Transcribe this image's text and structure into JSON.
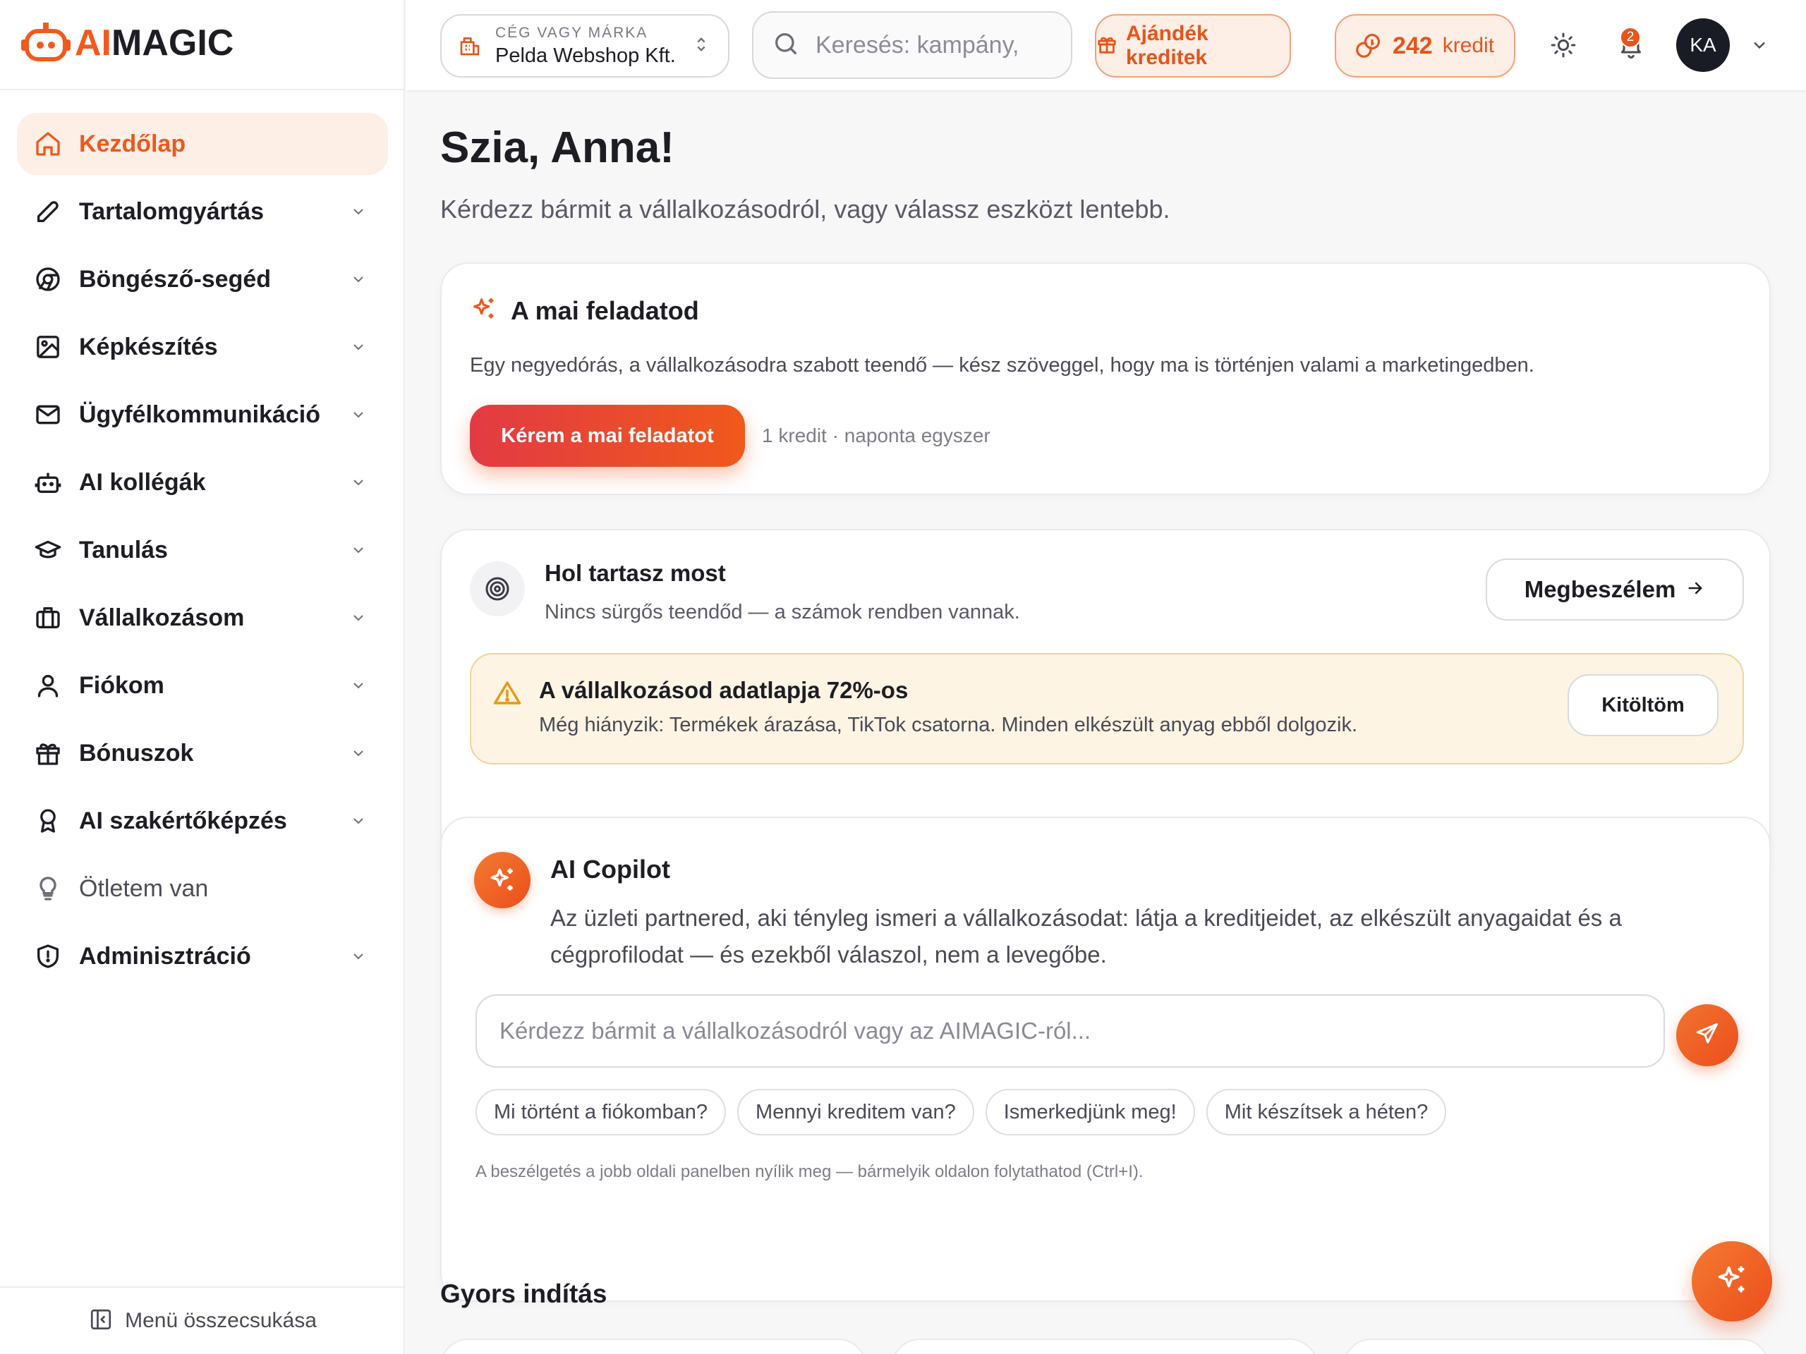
{
  "app": {
    "logo_ai": "AI",
    "logo_magic": "MAGIC"
  },
  "sidebar": {
    "items": [
      {
        "label": "Kezdőlap",
        "icon": "home-icon"
      },
      {
        "label": "Tartalomgyártás",
        "icon": "pen-icon"
      },
      {
        "label": "Böngésző-segéd",
        "icon": "chrome-icon"
      },
      {
        "label": "Képkészítés",
        "icon": "image-icon"
      },
      {
        "label": "Ügyfélkommunikáció",
        "icon": "mail-icon"
      },
      {
        "label": "AI kollégák",
        "icon": "robot-icon"
      },
      {
        "label": "Tanulás",
        "icon": "graduation-cap-icon"
      },
      {
        "label": "Vállalkozásom",
        "icon": "briefcase-icon"
      },
      {
        "label": "Fiókom",
        "icon": "user-icon"
      },
      {
        "label": "Bónuszok",
        "icon": "gift-icon"
      },
      {
        "label": "AI szakértőképzés",
        "icon": "award-icon"
      },
      {
        "label": "Ötletem van",
        "icon": "lightbulb-icon"
      },
      {
        "label": "Adminisztráció",
        "icon": "shield-icon"
      }
    ],
    "collapse_label": "Menü összecsukása"
  },
  "topbar": {
    "brand_caption": "CÉG VAGY MÁRKA",
    "brand_value": "Pelda Webshop Kft.",
    "search_placeholder": "Keresés: kampány,",
    "gift_label": "Ajándék kreditek",
    "credit_amount": "242",
    "credit_unit": "kredit",
    "notification_count": "2",
    "avatar_initials": "KA"
  },
  "main": {
    "greeting": "Szia, Anna!",
    "subtitle": "Kérdezz bármit a vállalkozásodról, vagy válassz eszközt lentebb.",
    "daily_task": {
      "title": "A mai feladatod",
      "description": "Egy negyedórás, a vállalkozásodra szabott teendő — kész szöveggel, hogy ma is történjen valami a marketingedben.",
      "button": "Kérem a mai feladatot",
      "note": "1 kredit · naponta egyszer"
    },
    "status": {
      "title": "Hol tartasz most",
      "subtitle": "Nincs sürgős teendőd — a számok rendben vannak.",
      "button": "Megbeszélem",
      "warning_title": "A vállalkozásod adatlapja 72%-os",
      "warning_text": "Még hiányzik: Termékek árazása, TikTok csatorna. Minden elkészült anyag ebből dolgozik.",
      "warning_button": "Kitöltöm"
    },
    "copilot": {
      "title": "AI Copilot",
      "description": "Az üzleti partnered, aki tényleg ismeri a vállalkozásodat: látja a kreditjeidet, az elkészült anyagaidat és a cégprofilodat — és ezekből válaszol, nem a levegőbe.",
      "input_placeholder": "Kérdezz bármit a vállalkozásodról vagy az AIMAGIC-ról...",
      "chips": [
        "Mi történt a fiókomban?",
        "Mennyi kreditem van?",
        "Ismerkedjünk meg!",
        "Mit készítsek a héten?"
      ],
      "footnote": "A beszélgetés a jobb oldali panelben nyílik meg — bármelyik oldalon folytathatod (Ctrl+I)."
    },
    "quick_start_title": "Gyors indítás"
  },
  "colors": {
    "accent": "#EC5A1C",
    "accent_light": "#FDEEE6",
    "warning_bg": "#FDF4E4",
    "warning_border": "#F3D29A"
  }
}
